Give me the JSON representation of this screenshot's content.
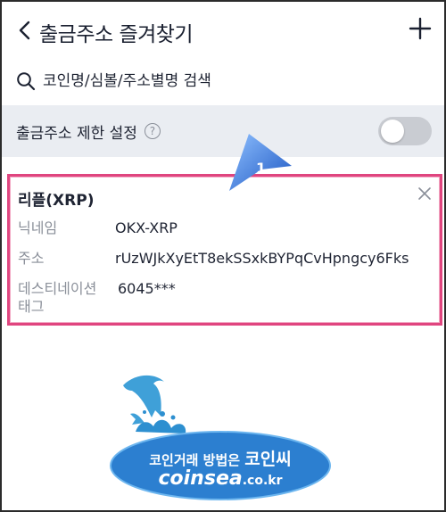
{
  "header": {
    "title": "출금주소 즐겨찾기",
    "back_icon": "chevron-left-icon",
    "add_icon": "plus-icon"
  },
  "search": {
    "placeholder": "코인명/심볼/주소별명 검색",
    "value": ""
  },
  "restriction": {
    "label": "출금주소 제한 설정",
    "enabled": false
  },
  "card": {
    "title": "리플(XRP)",
    "fields": [
      {
        "label": "닉네임",
        "value": "OKX-XRP"
      },
      {
        "label": "주소",
        "value": "rUzWJkXyEtT8ekSSxkBYPqCvHpngcy6Fks"
      },
      {
        "label": "데스티네이션\n태그",
        "value": "6045***"
      }
    ],
    "highlight_color": "#e0457f"
  },
  "callout": {
    "number": "1",
    "color": "#2f6fd6"
  },
  "watermark": {
    "brand_line": "코인거래 방법은",
    "brand_name": "코인씨",
    "domain": "coinsea",
    "domain_suffix": ".co.kr"
  },
  "colors": {
    "accent": "#1a2030",
    "muted": "#8a8f99",
    "band": "#eaedf2"
  }
}
